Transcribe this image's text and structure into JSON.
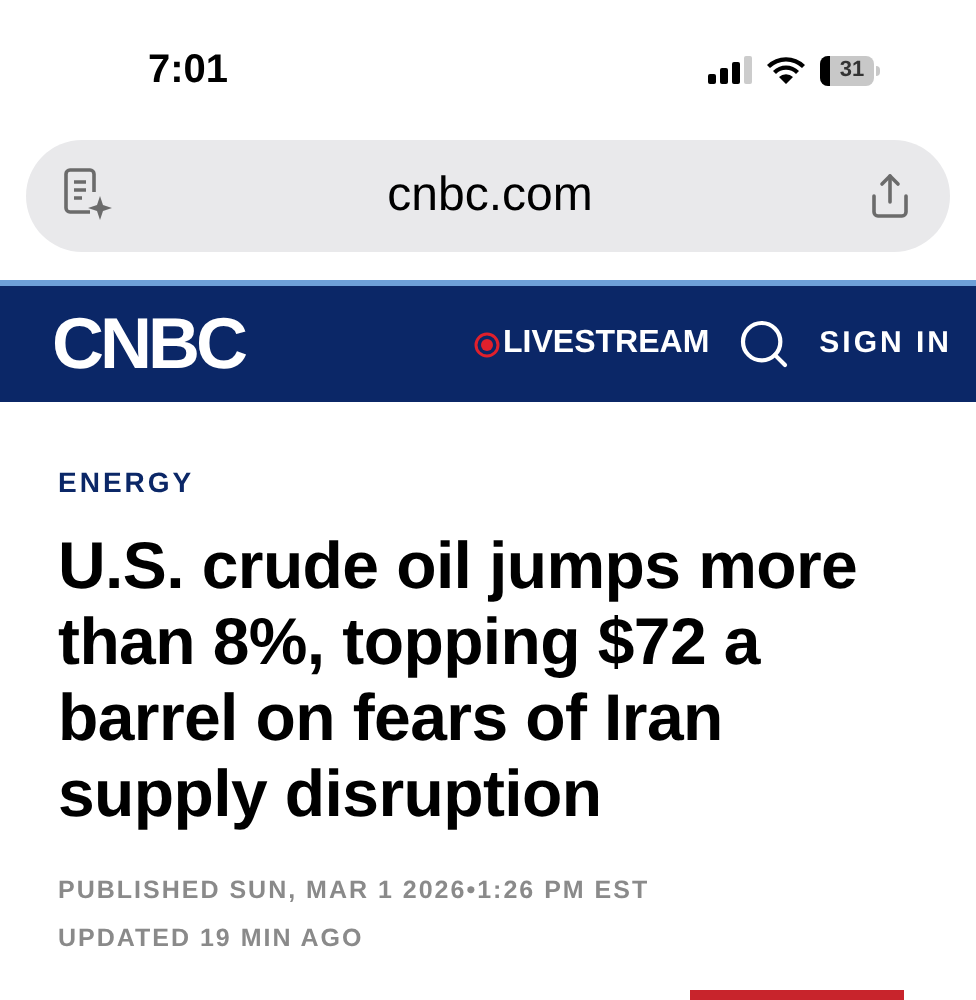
{
  "status_bar": {
    "time": "7:01",
    "battery": "31"
  },
  "address_bar": {
    "url": "cnbc.com"
  },
  "nav": {
    "logo": "CNBC",
    "livestream": "LIVESTREAM",
    "sign_in": "SIGN IN"
  },
  "article": {
    "section": "ENERGY",
    "headline": "U.S. crude oil jumps more than 8%, topping $72 a barrel on fears of Iran supply disruption",
    "published": "PUBLISHED SUN, MAR 1 2026•1:26 PM EST",
    "updated": "UPDATED 19 MIN AGO"
  }
}
